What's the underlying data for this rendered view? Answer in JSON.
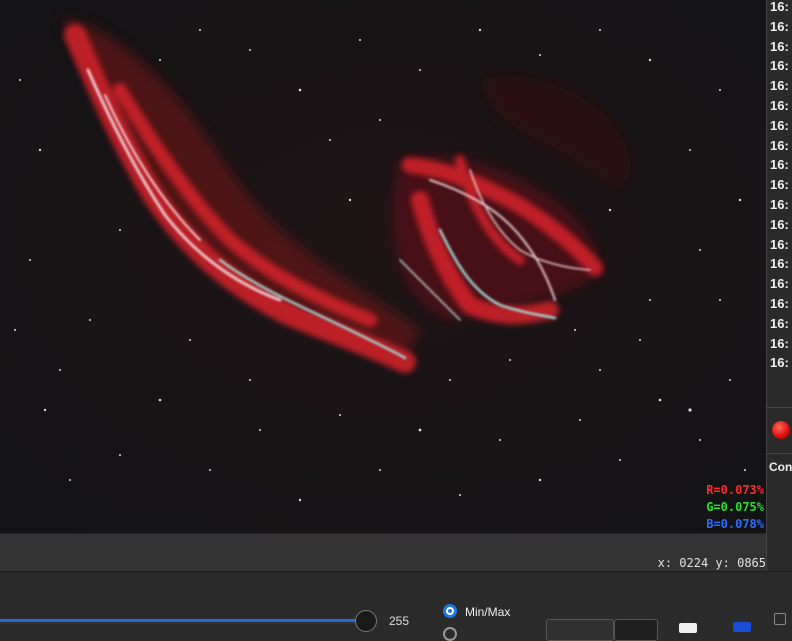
{
  "viewer": {
    "image_alt": "Veil Nebula astrophotograph",
    "stats": {
      "r": "R=0.073%",
      "g": "G=0.075%",
      "b": "B=0.078%"
    },
    "cursor_coords": "x: 0224 y: 0865"
  },
  "log_panel": {
    "lines": [
      "16:",
      "16:",
      "16:",
      "16:",
      "16:",
      "16:",
      "16:",
      "16:",
      "16:",
      "16:",
      "16:",
      "16:",
      "16:",
      "16:",
      "16:",
      "16:",
      "16:",
      "16:",
      "16:"
    ],
    "com_label": "Con",
    "record_color": "#e01010"
  },
  "bottom_bar": {
    "slider_value": "255",
    "stretch_option": "Min/Max",
    "accent": "#1f78e0"
  }
}
